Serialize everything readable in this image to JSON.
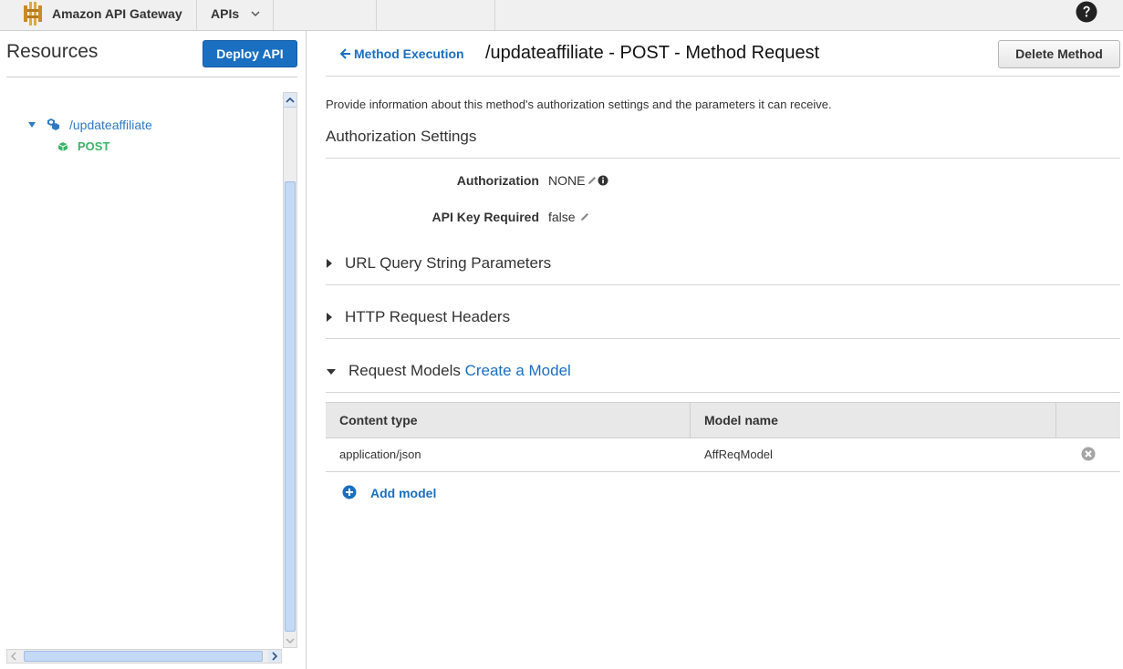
{
  "topbar": {
    "brand": "Amazon API Gateway",
    "apis_menu": "APIs"
  },
  "sidebar": {
    "title": "Resources",
    "deploy_label": "Deploy API",
    "tree": {
      "resource": "/updateaffiliate",
      "method": "POST"
    }
  },
  "main": {
    "back_label": "Method Execution",
    "title": "/updateaffiliate - POST - Method Request",
    "delete_label": "Delete Method",
    "description": "Provide information about this method's authorization settings and the parameters it can receive.",
    "auth_section": "Authorization Settings",
    "authorization": {
      "label": "Authorization",
      "value": "NONE"
    },
    "api_key": {
      "label": "API Key Required",
      "value": "false"
    },
    "sections": {
      "query": "URL Query String Parameters",
      "headers": "HTTP Request Headers",
      "models": "Request Models",
      "create_model": "Create a Model"
    },
    "table": {
      "headers": [
        "Content type",
        "Model name"
      ],
      "rows": [
        {
          "content_type": "application/json",
          "model_name": "AffReqModel"
        }
      ]
    },
    "add_model_label": "Add model"
  },
  "colors": {
    "accent": "#1a6fc0",
    "method_green": "#3cb36a"
  }
}
